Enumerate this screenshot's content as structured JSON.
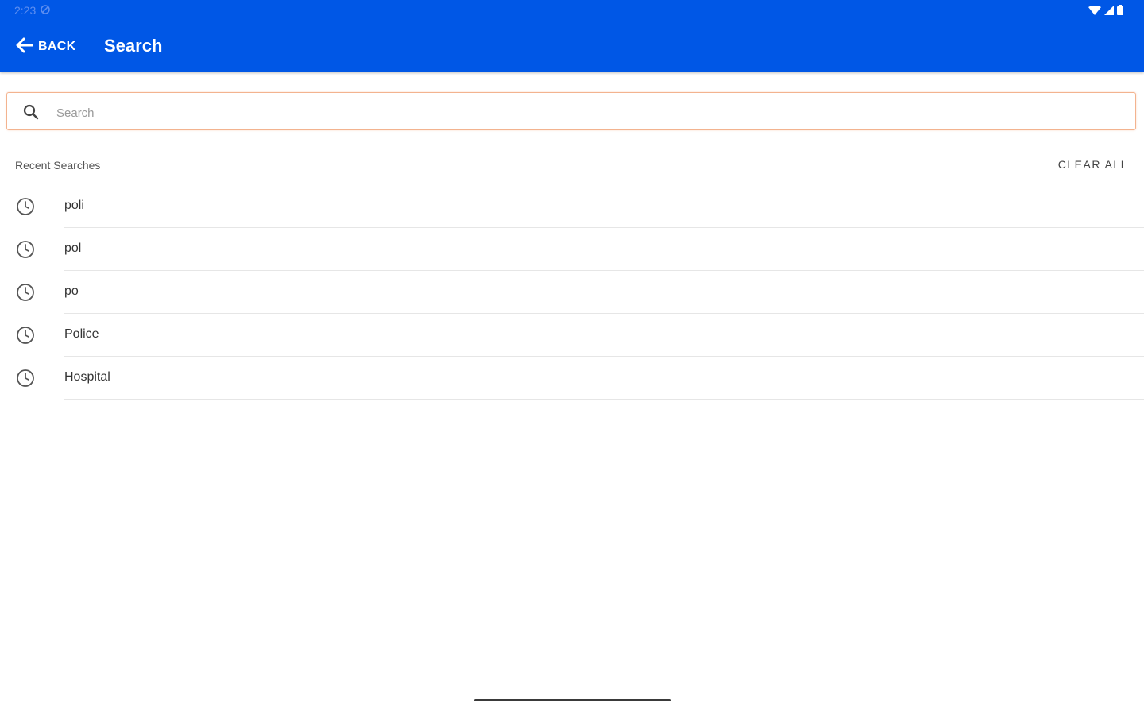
{
  "status_bar": {
    "time": "2:23"
  },
  "header": {
    "back_label": "BACK",
    "title": "Search"
  },
  "search": {
    "placeholder": "Search",
    "value": ""
  },
  "recent": {
    "heading": "Recent Searches",
    "clear_label": "CLEAR ALL",
    "items": [
      {
        "label": "poli"
      },
      {
        "label": "pol"
      },
      {
        "label": "po"
      },
      {
        "label": "Police"
      },
      {
        "label": "Hospital"
      }
    ]
  },
  "colors": {
    "appbar": "#0057e6",
    "search_border": "#f3b38f"
  }
}
